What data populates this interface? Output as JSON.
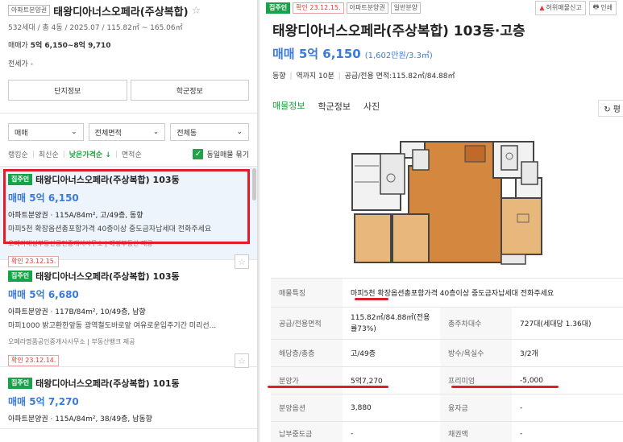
{
  "left": {
    "badge": "아파트분양권",
    "name": "태왕디아너스오페라(주상복합)",
    "star": "☆",
    "sub": "532세대 / 총 4동 / 2025.07 / 115.82㎡ ~ 165.06㎡",
    "price_label": "매매가",
    "price_value": "5억 6,150~8억 9,710",
    "jeonse": "전세가 -",
    "btn_complex": "단지정보",
    "btn_school": "학군정보",
    "filters": {
      "trade": "매매",
      "area": "전체면적",
      "dong": "전체동"
    },
    "sort": {
      "ranking": "랭킹순",
      "recent": "최신순",
      "low_price": "낮은가격순 ↓",
      "area": "면적순",
      "dedupe": "동일매물 묶기"
    },
    "listings": [
      {
        "tag": "집주인",
        "title": "태왕디아너스오페라(주상복합) 103동",
        "price": "매매 5억 6,150",
        "spec": "아파트분양권 · 115A/84m², 고/49층, 동향",
        "desc": "마피5천 확장옵션총포함가격 40층이상 중도금자납세대 전화주세요",
        "agent": "오페라대성부동산공인중개사사무소 | 매경부동산 제공",
        "confirm": ""
      },
      {
        "tag": "집주인",
        "title": "태왕디아너스오페라(주상복합) 103동",
        "price": "매매 5억 6,680",
        "spec": "아파트분양권 · 117B/84m², 10/49층, 남향",
        "desc": "마피1000 밝고환한앞동 광역철도바로앞 여유로운입주기간 미리선...",
        "agent": "오페라명품공인중개사사무소 | 부동산뱅크 제공",
        "confirm": "확인 23.12.14."
      },
      {
        "tag": "집주인",
        "title": "태왕디아너스오페라(주상복합) 101동",
        "price": "매매 5억 7,270",
        "spec": "아파트분양권 · 115A/84m², 38/49층, 남동향",
        "desc": "",
        "agent": "",
        "confirm": ""
      }
    ],
    "first_confirm": "확인 23.12.15."
  },
  "right": {
    "tags": [
      "집주인",
      "확인 23.12.15.",
      "아파트분양권",
      "일반분양"
    ],
    "report": "허위매물신고",
    "print": "인쇄",
    "title": "태왕디아너스오페라(주상복합) 103동·고층",
    "price": "매매 5억 6,150",
    "price_per": "(1,602만원/3.3㎡)",
    "meta": {
      "facing": "동향",
      "walk": "역까지 10분",
      "area": "공급/전용 면적:115.82㎡/84.88㎡"
    },
    "tabs": [
      "매물정보",
      "학군정보",
      "사진"
    ],
    "tab_right": "↻ 평",
    "table": {
      "feature_label": "매물특징",
      "feature_value": "마피5천 확장옵션총포함가격 40층이상 중도금자납세대 전화주세요",
      "area_label": "공급/전용면적",
      "area_value": "115.82㎡/84.88㎡(전용률73%)",
      "households_label": "총주차대수",
      "households_value": "727대(세대당 1.36대)",
      "floor_label": "해당층/총층",
      "floor_value": "고/49층",
      "rooms_label": "방수/욕실수",
      "rooms_value": "3/2개",
      "presale_label": "분양가",
      "presale_value": "5억7,270",
      "premium_label": "프리미엄",
      "premium_value": "-5,000",
      "option_label": "분양옵션",
      "option_value": "3,880",
      "loan_label": "융자금",
      "loan_value": "-",
      "payment_label": "납부중도금",
      "payment_value": "-",
      "bond_label": "채권액",
      "bond_value": "-"
    }
  },
  "colors": {
    "accent_green": "#1aa33a",
    "price_blue": "#3b7bd8",
    "highlight_red": "#e11d2a"
  }
}
